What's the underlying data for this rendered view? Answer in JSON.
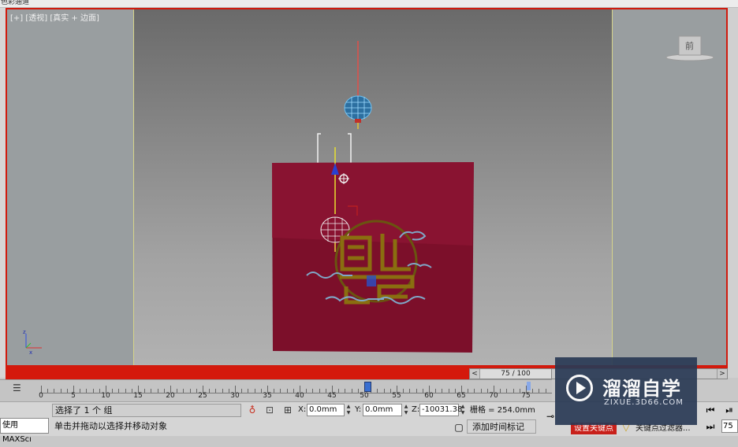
{
  "window": {
    "title": "色彩通道"
  },
  "viewport": {
    "label": "[+] [透视] [真实 + 边面]",
    "viewcube_label": "前"
  },
  "time_slider": {
    "prev": "<",
    "position": "75 / 100",
    "next": ">"
  },
  "trackbar": {
    "ticks": [
      "0",
      "5",
      "10",
      "15",
      "20",
      "25",
      "30",
      "35",
      "40",
      "45",
      "50",
      "55",
      "60",
      "65",
      "70",
      "75"
    ]
  },
  "status": {
    "maxscript_label": "使用 MAXScı",
    "selection": "选择了 1 个 组",
    "prompt": "单击并拖动以选择并移动对象",
    "x_label": "X:",
    "x_value": "0.0mm",
    "y_label": "Y:",
    "y_value": "0.0mm",
    "z_label": "Z:",
    "z_value": "-10031.38",
    "grid": "栅格 = 254.0mm",
    "add_time_tag": "添加时间标记",
    "auto_key": "设置关键点",
    "key_filters": "关键点过滤器...",
    "frame": "75"
  },
  "watermark": {
    "title": "溜溜自学",
    "url": "ZIXUE.3D66.COM"
  },
  "colors": {
    "accent": "#d4190c",
    "panel": "#8a1030",
    "gold": "#8a6a10"
  }
}
